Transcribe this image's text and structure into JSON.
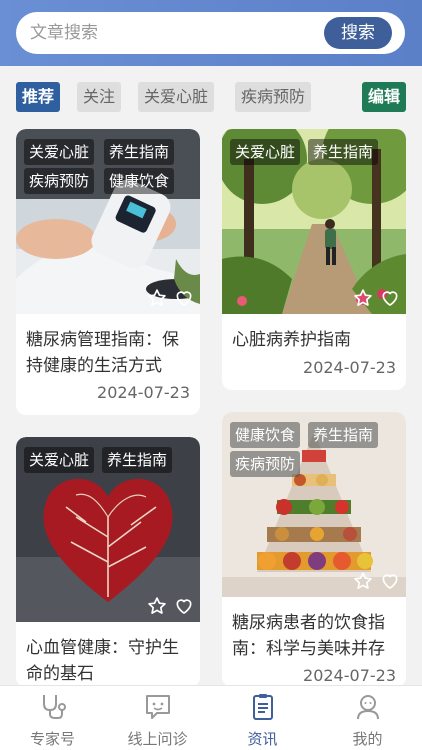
{
  "search": {
    "placeholder": "文章搜索",
    "button": "搜索"
  },
  "tabs": [
    {
      "label": "推荐",
      "active": true
    },
    {
      "label": "关注"
    },
    {
      "label": "关爱心脏"
    },
    {
      "label": "疾病预防"
    }
  ],
  "edit_label": "编辑",
  "cards": [
    {
      "tags": [
        "关爱心脏",
        "养生指南",
        "疾病预防",
        "健康饮食"
      ],
      "title": "糖尿病管理指南：保持健康的生活方式",
      "date": "2024-07-23",
      "image": "glucose-meter-photo"
    },
    {
      "tags": [
        "关爱心脏",
        "养生指南"
      ],
      "title": "心脏病养护指南",
      "date": "2024-07-23",
      "image": "park-jogger-photo"
    },
    {
      "tags": [
        "关爱心脏",
        "养生指南"
      ],
      "title": "心血管健康：守护生命的基石",
      "date": "",
      "image": "heart-veins-photo"
    },
    {
      "tags": [
        "健康饮食",
        "养生指南",
        "疾病预防"
      ],
      "title": "糖尿病患者的饮食指南：科学与美味并存",
      "date": "2024-07-23",
      "image": "food-pyramid-photo"
    }
  ],
  "nav": [
    {
      "label": "专家号",
      "icon": "stethoscope-icon"
    },
    {
      "label": "线上问诊",
      "icon": "chat-bubble-icon"
    },
    {
      "label": "资讯",
      "icon": "news-clipboard-icon",
      "active": true
    },
    {
      "label": "我的",
      "icon": "user-icon"
    }
  ],
  "colors": {
    "header": "#5b80c8",
    "accent": "#3f5f9a",
    "edit": "#1f7a56",
    "active_tab": "#2f5f9f"
  }
}
